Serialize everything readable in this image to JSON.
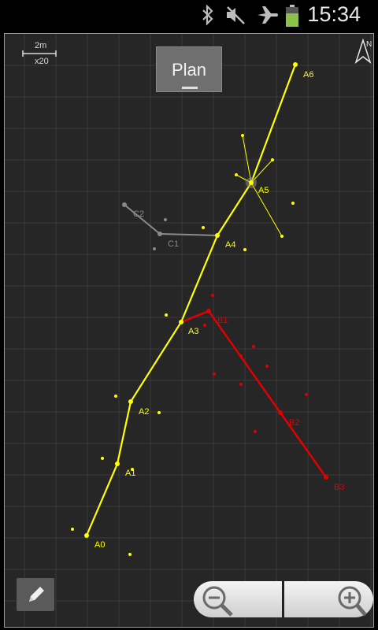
{
  "status_bar": {
    "time": "15:34"
  },
  "toolbar": {
    "plan_label": "Plan"
  },
  "scale": {
    "distance": "2m",
    "zoom": "x20"
  },
  "compass": {
    "north_label": "N"
  },
  "colors": {
    "series_a": "#ffff00",
    "series_b": "#e00000",
    "series_c": "#8a8a8a",
    "background": "#262626",
    "grid": "#3a3a3a"
  },
  "stations": {
    "a": [
      "A0",
      "A1",
      "A2",
      "A3",
      "A4",
      "A5",
      "A6"
    ],
    "b": [
      "B1",
      "B2",
      "B3"
    ],
    "c": [
      "C1",
      "C2"
    ]
  },
  "icons": [
    "bluetooth-icon",
    "mute-icon",
    "airplane-icon",
    "battery-icon",
    "compass-north-icon",
    "pencil-icon",
    "zoom-out-icon",
    "zoom-in-icon"
  ]
}
